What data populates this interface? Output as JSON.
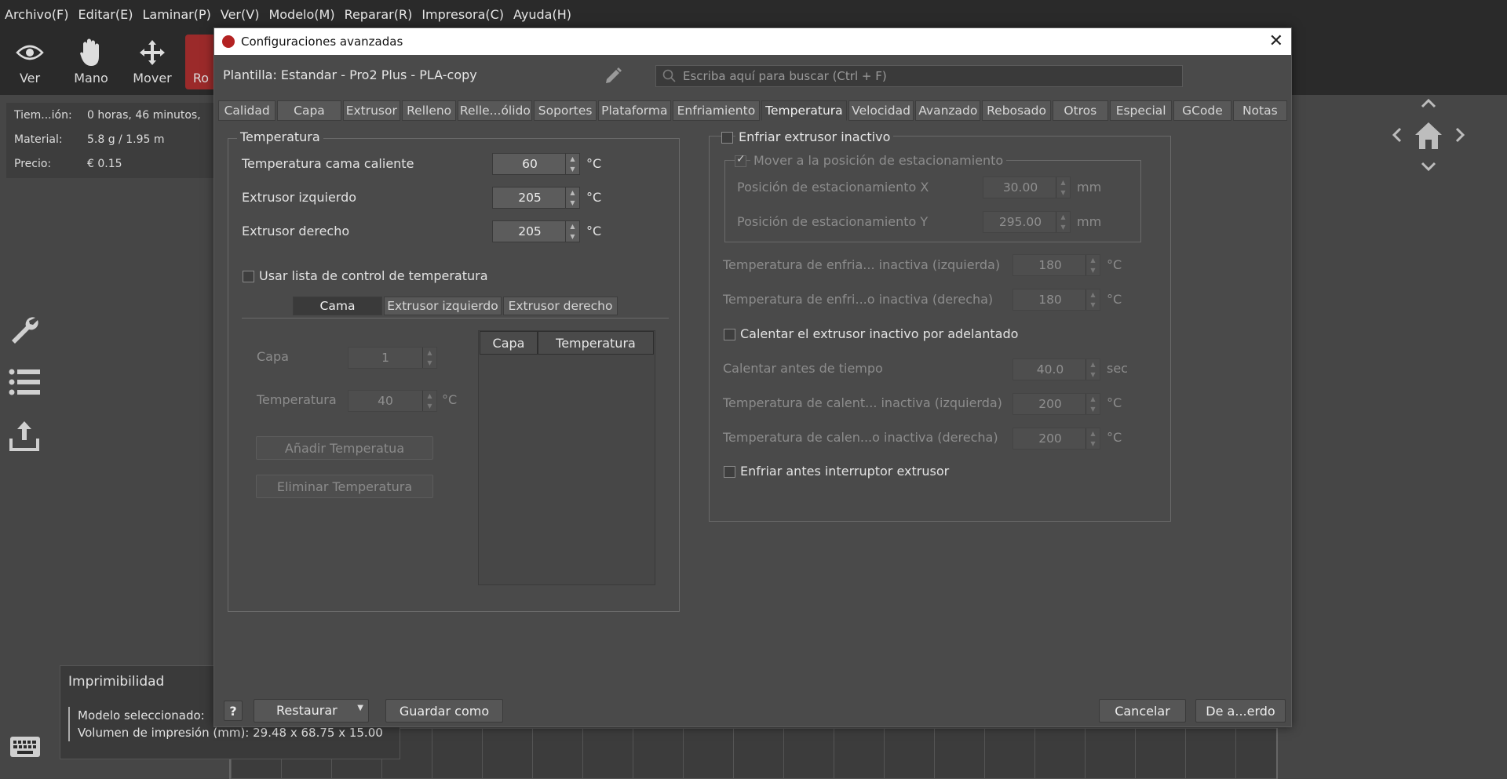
{
  "menu": [
    "Archivo(F)",
    "Editar(E)",
    "Laminar(P)",
    "Ver(V)",
    "Modelo(M)",
    "Reparar(R)",
    "Impresora(C)",
    "Ayuda(H)"
  ],
  "toolbar": {
    "ver": "Ver",
    "mano": "Mano",
    "mover": "Mover",
    "rotar": "Ro"
  },
  "info": {
    "tiempo_label": "Tiem...ión:",
    "tiempo_value": "0 horas, 46 minutos,",
    "material_label": "Material:",
    "material_value": "5.8 g / 1.95 m",
    "precio_label": "Precio:",
    "precio_value": "€ 0.15"
  },
  "printability": {
    "title": "Imprimibilidad",
    "line1": "Modelo seleccionado:",
    "line2": "Volumen de impresión (mm): 29.48 x 68.75 x 15.00"
  },
  "dialog": {
    "title": "Configuraciones avanzadas",
    "preset": "Plantilla: Estandar - Pro2 Plus - PLA-copy",
    "search_placeholder": "Escriba aquí para buscar (Ctrl + F)",
    "tabs": [
      "Calidad",
      "Capa",
      "Extrusor",
      "Relleno",
      "Relle...ólido",
      "Soportes",
      "Plataforma",
      "Enfriamiento",
      "Temperatura",
      "Velocidad",
      "Avanzado",
      "Rebosado",
      "Otros",
      "Especial",
      "GCode",
      "Notas"
    ],
    "active_tab": "Temperatura"
  },
  "temp": {
    "group_title": "Temperatura",
    "bed_label": "Temperatura cama caliente",
    "bed_value": "60",
    "left_label": "Extrusor izquierdo",
    "left_value": "205",
    "right_label": "Extrusor derecho",
    "right_value": "205",
    "unit_c": "°C",
    "use_list_label": "Usar lista de control de temperatura",
    "subtabs": [
      "Cama",
      "Extrusor izquierdo",
      "Extrusor derecho"
    ],
    "capa_label": "Capa",
    "capa_value": "1",
    "temperatura_label": "Temperatura",
    "temperatura_value": "40",
    "add_button": "Añadir Temperatua",
    "remove_button": "Eliminar Temperatura",
    "col_capa": "Capa",
    "col_temp": "Temperatura"
  },
  "cool": {
    "enfriar_label": "Enfriar extrusor inactivo",
    "park_label": "Mover a la posición de estacionamiento",
    "park_x_label": "Posición de estacionamiento X",
    "park_x_value": "30.00",
    "park_y_label": "Posición de estacionamiento Y",
    "park_y_value": "295.00",
    "unit_mm": "mm",
    "cool_left_label": "Temperatura de enfria... inactiva (izquierda)",
    "cool_left_value": "180",
    "cool_right_label": "Temperatura de enfri...o inactiva (derecha)",
    "cool_right_value": "180",
    "preheat_label": "Calentar el extrusor inactivo por adelantado",
    "preheat_time_label": "Calentar antes de tiempo",
    "preheat_time_value": "40.0",
    "unit_sec": "sec",
    "heat_left_label": "Temperatura de calent... inactiva (izquierda)",
    "heat_left_value": "200",
    "heat_right_label": "Temperatura de calen...o inactiva (derecha)",
    "heat_right_value": "200",
    "cool_before_switch_label": "Enfriar antes interruptor extrusor"
  },
  "footer": {
    "help": "?",
    "restore": "Restaurar",
    "save_as": "Guardar como",
    "cancel": "Cancelar",
    "ok": "De a...erdo"
  }
}
